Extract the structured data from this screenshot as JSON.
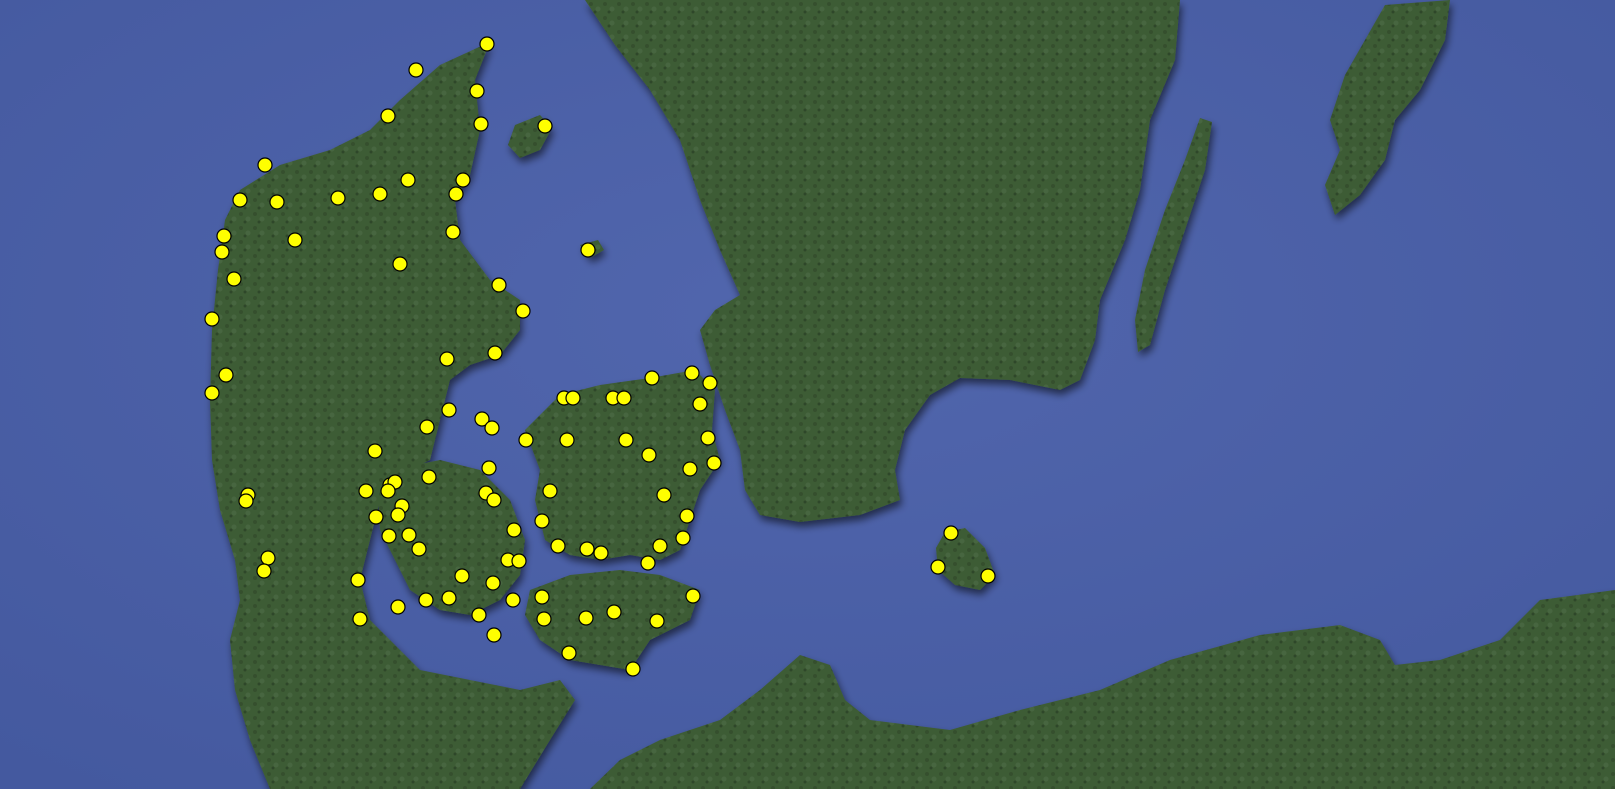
{
  "map": {
    "type": "satellite",
    "colors": {
      "sea": "#4b5fa6",
      "sea_deep": "#3e519a",
      "land": "#3d5a33",
      "land_dark": "#2c4426",
      "land_light": "#4f6b3e",
      "marker_fill": "#ffff00",
      "marker_stroke": "#000000"
    },
    "marker_icon": "yellow-circle-marker",
    "marker_count": 129
  }
}
